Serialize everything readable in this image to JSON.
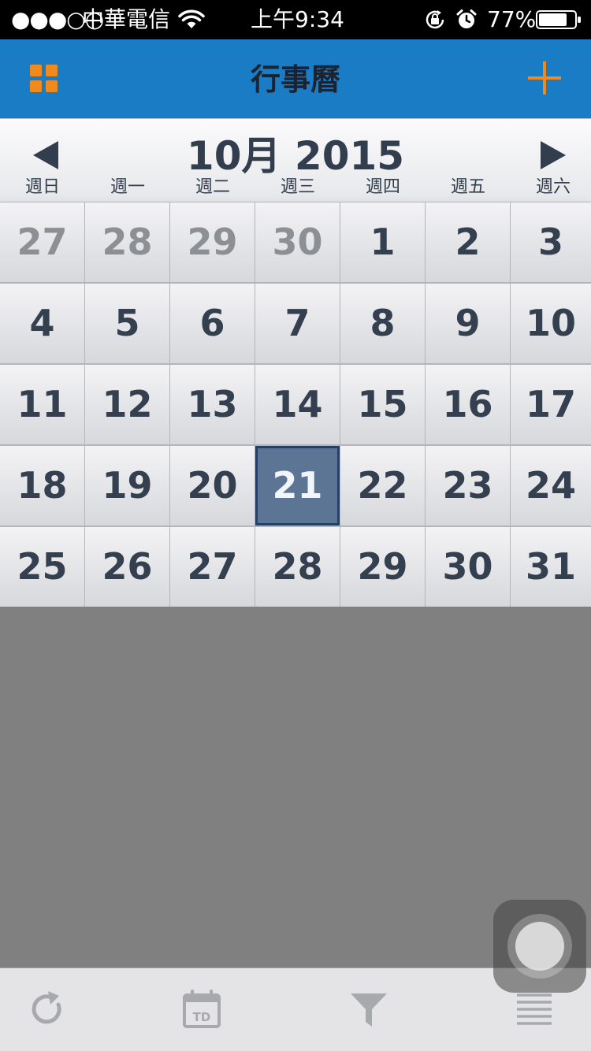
{
  "status_bar": {
    "signal": "●●●○○",
    "carrier": "中華電信",
    "time": "上午9:34",
    "battery_percent": "77%",
    "icons": [
      "wifi-icon",
      "orientation-lock-icon",
      "alarm-icon",
      "battery-icon"
    ]
  },
  "nav": {
    "title": "行事曆",
    "left_icon": "grid-menu-icon",
    "right_icon": "plus-icon",
    "accent_color": "#f08a1c",
    "bar_color": "#1a7cc4"
  },
  "calendar": {
    "month_label": "10月 2015",
    "prev_icon": "triangle-left-icon",
    "next_icon": "triangle-right-icon",
    "weekdays": [
      "週日",
      "週一",
      "週二",
      "週三",
      "週四",
      "週五",
      "週六"
    ],
    "weeks": [
      [
        {
          "day": "27",
          "other_month": true
        },
        {
          "day": "28",
          "other_month": true
        },
        {
          "day": "29",
          "other_month": true
        },
        {
          "day": "30",
          "other_month": true
        },
        {
          "day": "1"
        },
        {
          "day": "2"
        },
        {
          "day": "3"
        }
      ],
      [
        {
          "day": "4"
        },
        {
          "day": "5"
        },
        {
          "day": "6"
        },
        {
          "day": "7"
        },
        {
          "day": "8"
        },
        {
          "day": "9"
        },
        {
          "day": "10"
        }
      ],
      [
        {
          "day": "11"
        },
        {
          "day": "12"
        },
        {
          "day": "13"
        },
        {
          "day": "14"
        },
        {
          "day": "15"
        },
        {
          "day": "16"
        },
        {
          "day": "17"
        }
      ],
      [
        {
          "day": "18"
        },
        {
          "day": "19"
        },
        {
          "day": "20"
        },
        {
          "day": "21",
          "selected": true
        },
        {
          "day": "22"
        },
        {
          "day": "23"
        },
        {
          "day": "24"
        }
      ],
      [
        {
          "day": "25"
        },
        {
          "day": "26"
        },
        {
          "day": "27"
        },
        {
          "day": "28"
        },
        {
          "day": "29"
        },
        {
          "day": "30"
        },
        {
          "day": "31"
        }
      ]
    ],
    "selected_color": "#5d7595"
  },
  "toolbar": {
    "items": [
      {
        "icon": "refresh-icon"
      },
      {
        "icon": "today-calendar-icon",
        "badge_text": "TD"
      },
      {
        "icon": "filter-icon"
      },
      {
        "icon": "list-icon"
      }
    ]
  }
}
